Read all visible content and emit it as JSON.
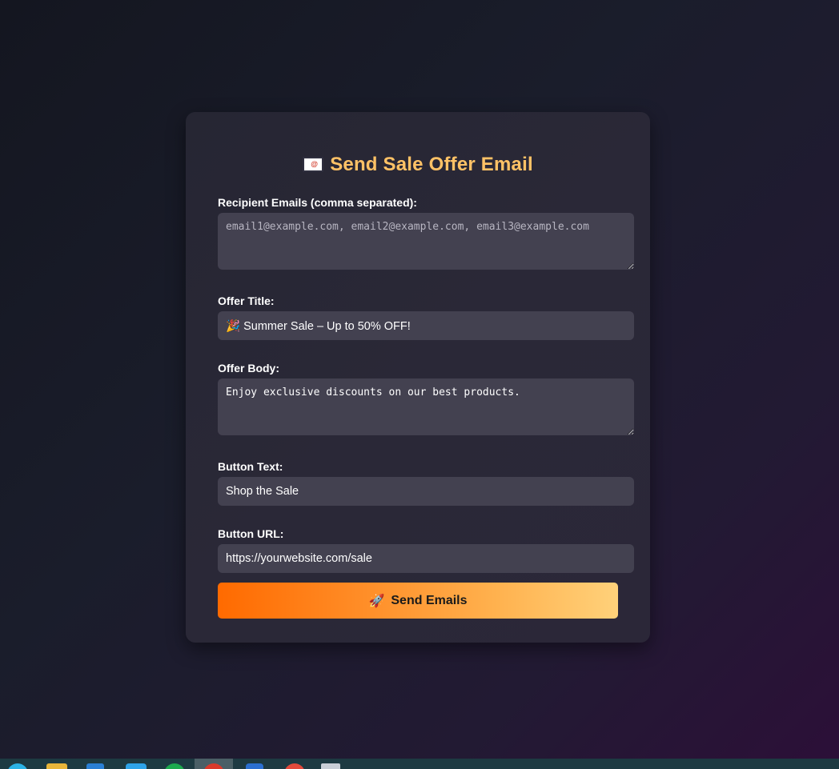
{
  "form": {
    "title": "Send Sale Offer Email",
    "title_icon": "envelope-icon",
    "recipients": {
      "label": "Recipient Emails (comma separated):",
      "placeholder": "email1@example.com, email2@example.com, email3@example.com",
      "value": ""
    },
    "offer_title": {
      "label": "Offer Title:",
      "value": "🎉 Summer Sale – Up to 50% OFF!"
    },
    "offer_body": {
      "label": "Offer Body:",
      "value": "Enjoy exclusive discounts on our best products."
    },
    "button_text": {
      "label": "Button Text:",
      "value": "Shop the Sale"
    },
    "button_url": {
      "label": "Button URL:",
      "value": "https://yourwebsite.com/sale"
    },
    "submit": {
      "icon": "🚀",
      "label": "Send Emails"
    }
  },
  "colors": {
    "accent": "#ffc266",
    "button_gradient_start": "#ff6a00",
    "button_gradient_end": "#ffd17a",
    "card_bg": "#2a2837",
    "input_bg": "#434150"
  },
  "taskbar": {
    "icons": [
      "browser-icon",
      "folder-icon",
      "store-icon",
      "vscode-icon",
      "whatsapp-icon",
      "chrome-icon",
      "edge-icon",
      "app-icon",
      "notepad-icon"
    ]
  }
}
